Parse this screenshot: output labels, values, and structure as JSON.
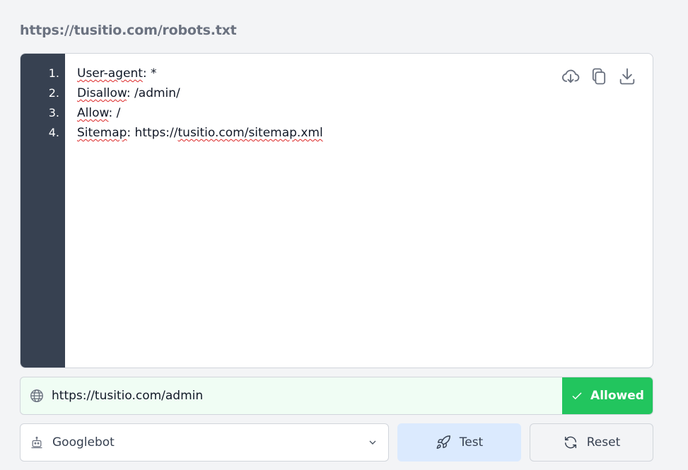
{
  "robots_url": "https://tusitio.com/robots.txt",
  "editor": {
    "line_numbers": [
      "1.",
      "2.",
      "3.",
      "4."
    ],
    "lines": [
      {
        "key": "User-agent",
        "rest": ": *"
      },
      {
        "key": "Disallow",
        "rest": ": /admin/"
      },
      {
        "key": "Allow",
        "rest": ": /"
      },
      {
        "key": "Sitemap",
        "rest": ": https://",
        "url": "tusitio.com/sitemap.xml"
      }
    ],
    "toolbar_icons": [
      "cloud-download-icon",
      "copy-icon",
      "download-icon"
    ]
  },
  "test": {
    "url_value": "https://tusitio.com/admin",
    "result_label": "Allowed",
    "result_color": "#22c55e",
    "background_color": "#f0fdf4"
  },
  "agent": {
    "selected": "Googlebot"
  },
  "buttons": {
    "test_label": "Test",
    "reset_label": "Reset"
  }
}
